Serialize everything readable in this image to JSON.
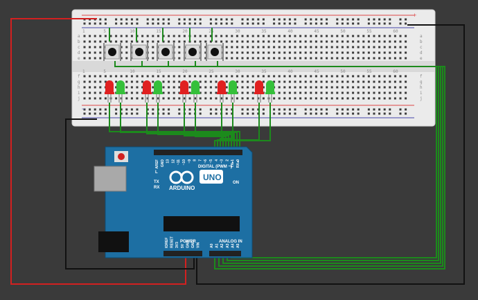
{
  "breadboard": {
    "column_numbers": [
      "1",
      "5",
      "10",
      "15",
      "20",
      "25",
      "30",
      "35",
      "40",
      "45",
      "50",
      "55",
      "60"
    ],
    "row_letters_top": [
      "a",
      "b",
      "c",
      "d",
      "e"
    ],
    "row_letters_bottom": [
      "f",
      "g",
      "h",
      "i",
      "j"
    ],
    "rail_plus": "+",
    "rail_minus": "−",
    "buttons": 5,
    "led_pairs": 5,
    "led_colors": {
      "red": "#e02020",
      "green": "#35c03a"
    }
  },
  "arduino": {
    "brand": "ARDUINO",
    "model": "UNO",
    "digital_label": "DIGITAL (PWM ~)",
    "analog_label": "ANALOG IN",
    "power_label": "POWER",
    "on_label": "ON",
    "led_l": "L",
    "led_tx": "TX",
    "led_rx": "RX",
    "digital_pins": [
      "AREF",
      "GND",
      "13",
      "12",
      "~11",
      "~10",
      "~9",
      "8",
      "7",
      "~6",
      "~5",
      "4",
      "~3",
      "2",
      "TX▸1",
      "RX◂0"
    ],
    "power_pins": [
      "IOREF",
      "RESET",
      "3V3",
      "5V",
      "GND",
      "GND",
      "VIN"
    ],
    "analog_pins": [
      "A0",
      "A1",
      "A2",
      "A3",
      "A4",
      "A5"
    ]
  },
  "wire_colors": {
    "red": "#d42020",
    "black": "#111111",
    "green": "#1c8a1c"
  }
}
